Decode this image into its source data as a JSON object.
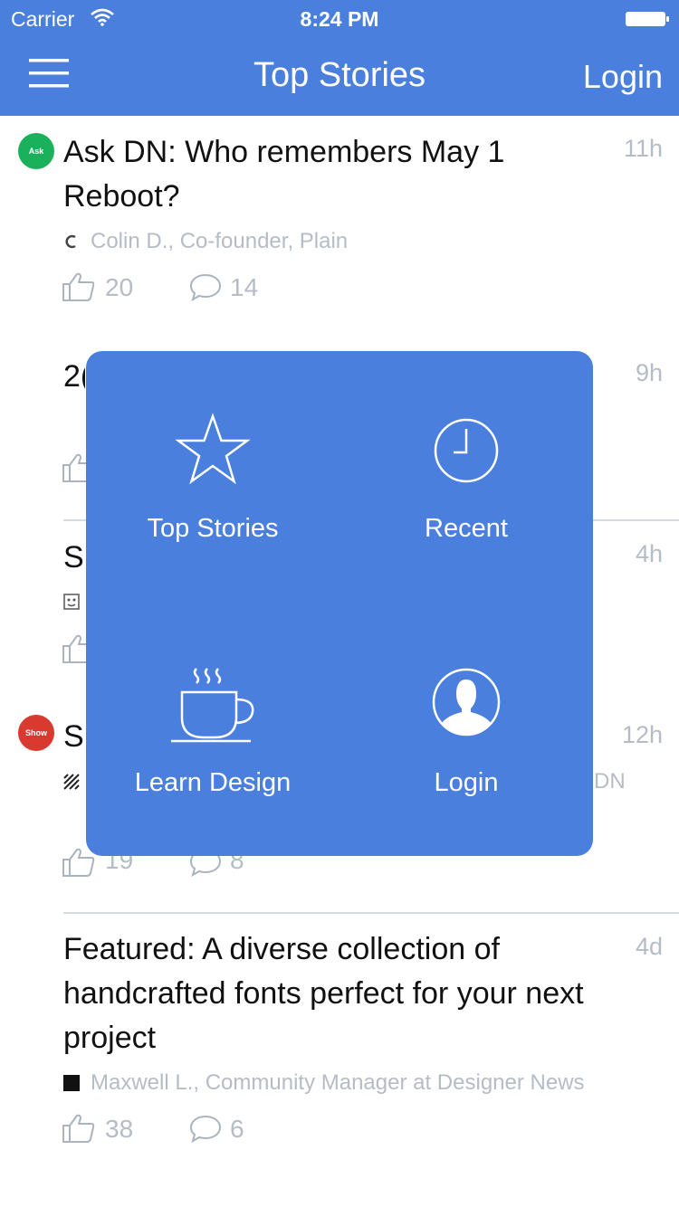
{
  "status_bar": {
    "carrier": "Carrier",
    "time": "8:24 PM"
  },
  "nav": {
    "title": "Top Stories",
    "login_label": "Login"
  },
  "stories": [
    {
      "badge": "Ask",
      "badge_color": "#1ab15d",
      "title": "Ask DN: Who remembers May 1 Reboot?",
      "time": "11h",
      "author": "Colin D., Co-founder, Plain",
      "likes": "20",
      "comments": "14"
    },
    {
      "title_fragment": "2(",
      "time": "9h"
    },
    {
      "title_fragment": "Si",
      "time": "4h"
    },
    {
      "badge": "Show",
      "badge_color": "#d93a30",
      "title_fragment": "Sl",
      "time": "12h",
      "author_fragment": "DN",
      "likes_fragment": "19",
      "comments_fragment": "8"
    },
    {
      "title": "Featured: A diverse collection of handcrafted fonts perfect for your next project",
      "time": "4d",
      "author": "Maxwell L., Community Manager at Designer News",
      "likes": "38",
      "comments": "6"
    }
  ],
  "popup_menu": {
    "items": [
      {
        "label": "Top Stories",
        "icon": "star-icon"
      },
      {
        "label": "Recent",
        "icon": "clock-icon"
      },
      {
        "label": "Learn Design",
        "icon": "coffee-cup-icon"
      },
      {
        "label": "Login",
        "icon": "user-icon"
      }
    ]
  },
  "colors": {
    "brand_blue": "#4a7fdd",
    "meta_gray": "#b6bcc5"
  }
}
